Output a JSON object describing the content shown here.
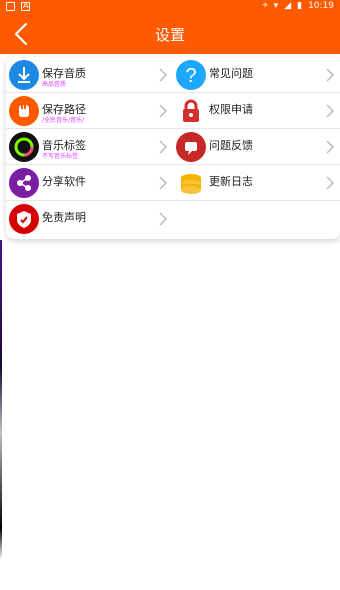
{
  "status": {
    "time": "10:19"
  },
  "header": {
    "title": "设置"
  },
  "items": [
    {
      "label": "保存音质",
      "sub": "高品音质",
      "icon": "download-icon",
      "color": "#1e88e5"
    },
    {
      "label": "常见问题",
      "sub": "",
      "icon": "question-icon",
      "color": "#1ea7ff"
    },
    {
      "label": "保存路径",
      "sub": "/全民音乐/音乐/",
      "icon": "hand-icon",
      "color": "#ff5a00"
    },
    {
      "label": "权限申请",
      "sub": "",
      "icon": "lock-icon",
      "color": "#d32f2f"
    },
    {
      "label": "音乐标签",
      "sub": "不写音乐标签",
      "icon": "ring-icon",
      "color": "#111111"
    },
    {
      "label": "问题反馈",
      "sub": "",
      "icon": "message-icon",
      "color": "#c62828"
    },
    {
      "label": "分享软件",
      "sub": "",
      "icon": "share-icon",
      "color": "#7b1fa2"
    },
    {
      "label": "更新日志",
      "sub": "",
      "icon": "coins-icon",
      "color": "#f4b400"
    },
    {
      "label": "免责声明",
      "sub": "",
      "icon": "shield-icon",
      "color": "#d50000"
    }
  ]
}
